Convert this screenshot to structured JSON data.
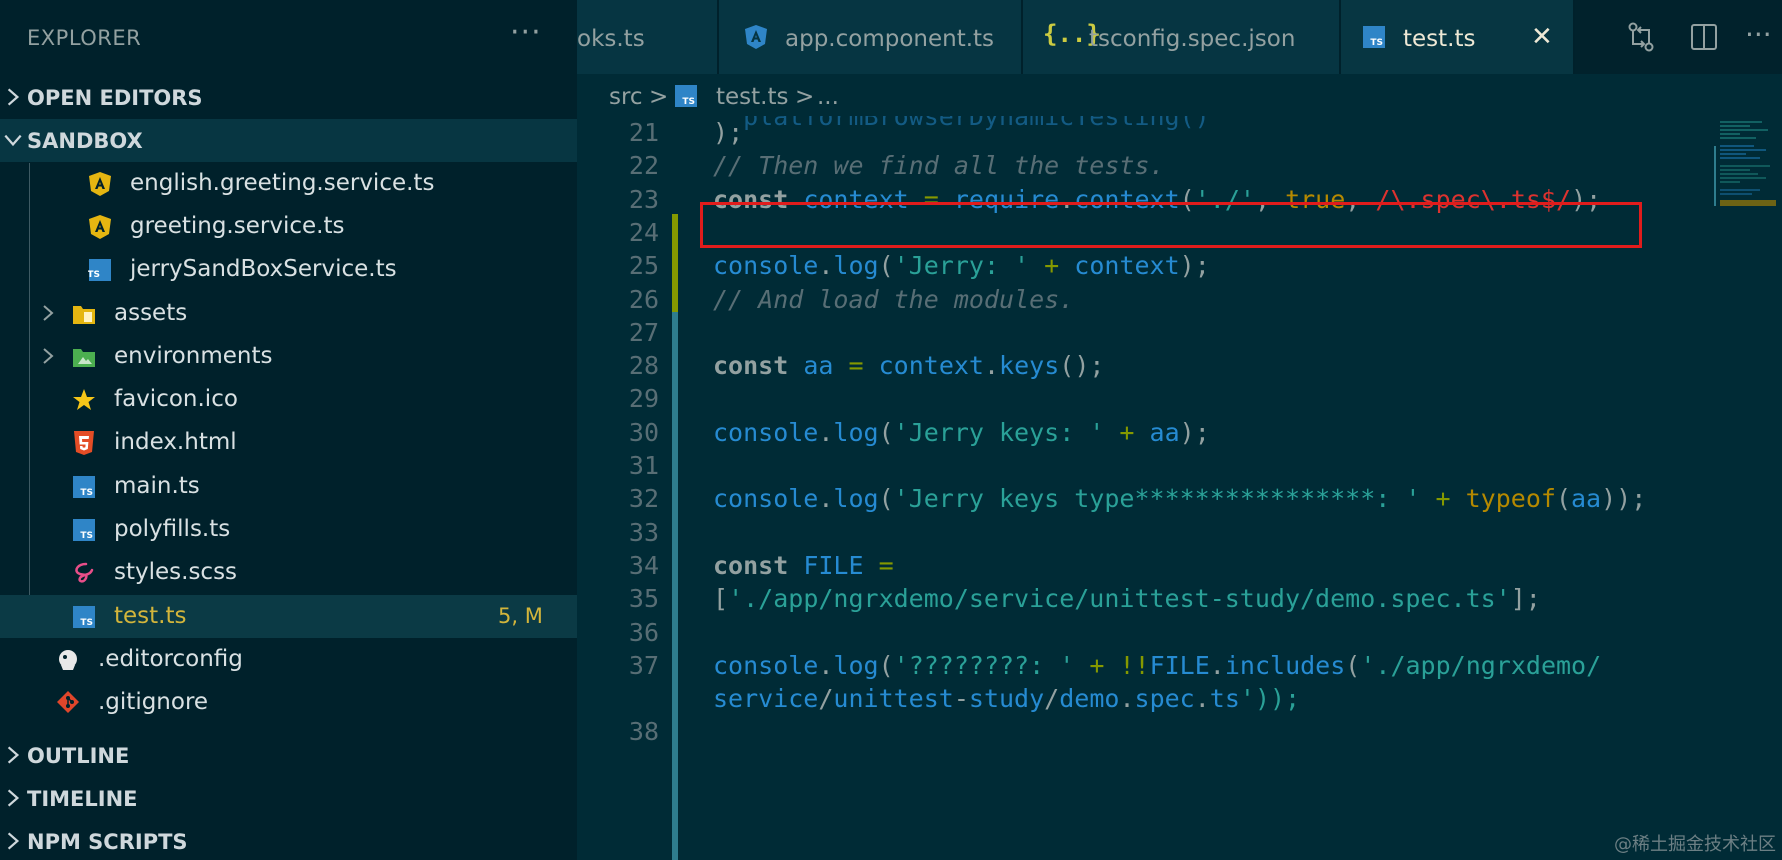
{
  "sidebar": {
    "title": "EXPLORER",
    "more": "···",
    "sections": {
      "open_editors": "OPEN EDITORS",
      "sandbox": "SANDBOX",
      "outline": "OUTLINE",
      "timeline": "TIMELINE",
      "npm_scripts": "NPM SCRIPTS"
    },
    "files": [
      {
        "name": "english.greeting.service.ts",
        "icon": "angular-icon"
      },
      {
        "name": "greeting.service.ts",
        "icon": "angular-icon"
      },
      {
        "name": "jerrySandBoxService.ts",
        "icon": "ts-icon"
      },
      {
        "name": "assets",
        "icon": "folder-assets-icon"
      },
      {
        "name": "environments",
        "icon": "folder-environments-icon"
      },
      {
        "name": "favicon.ico",
        "icon": "star-icon"
      },
      {
        "name": "index.html",
        "icon": "html5-icon"
      },
      {
        "name": "main.ts",
        "icon": "ts-icon"
      },
      {
        "name": "polyfills.ts",
        "icon": "ts-icon"
      },
      {
        "name": "styles.scss",
        "icon": "sass-icon"
      },
      {
        "name": "test.ts",
        "icon": "ts-icon",
        "badge": "5, M"
      },
      {
        "name": ".editorconfig",
        "icon": "editorconfig-icon"
      },
      {
        "name": ".gitignore",
        "icon": "git-icon"
      }
    ]
  },
  "tabs": [
    {
      "label": "oks.ts"
    },
    {
      "label": "app.component.ts",
      "icon": "angular-icon"
    },
    {
      "label": "tsconfig.spec.json",
      "icon": "json-icon"
    },
    {
      "label": "test.ts",
      "icon": "ts-icon",
      "active": true,
      "close": "✕"
    }
  ],
  "breadcrumb": {
    "folder": "src",
    "sep": ">",
    "file": "test.ts",
    "tail": "..."
  },
  "editor": {
    "lines": [
      {
        "n": "21",
        "code": ");"
      },
      {
        "n": "22",
        "code": "// Then we find all the tests."
      },
      {
        "n": "23",
        "code": "const context = require.context('./', true, /\\.spec\\.ts$/);"
      },
      {
        "n": "24",
        "code": ""
      },
      {
        "n": "25",
        "code": "console.log('Jerry: ' + context);"
      },
      {
        "n": "26",
        "code": "// And load the modules."
      },
      {
        "n": "27",
        "code": ""
      },
      {
        "n": "28",
        "code": "const aa = context.keys();"
      },
      {
        "n": "29",
        "code": ""
      },
      {
        "n": "30",
        "code": "console.log('Jerry keys: ' + aa);"
      },
      {
        "n": "31",
        "code": ""
      },
      {
        "n": "32",
        "code": "console.log('Jerry keys type****************: ' + typeof(aa));"
      },
      {
        "n": "33",
        "code": ""
      },
      {
        "n": "34",
        "code": "const FILE ="
      },
      {
        "n": "35",
        "code": "['./app/ngrxdemo/service/unittest-study/demo.spec.ts'];"
      },
      {
        "n": "36",
        "code": ""
      },
      {
        "n": "37",
        "code": "console.log('????????: ' + !!FILE.includes('./app/ngrxdemo/"
      },
      {
        "n": "",
        "code": "service/unittest-study/demo.spec.ts'));"
      },
      {
        "n": "38",
        "code": ""
      }
    ]
  },
  "watermark": "@稀土掘金技术社区"
}
